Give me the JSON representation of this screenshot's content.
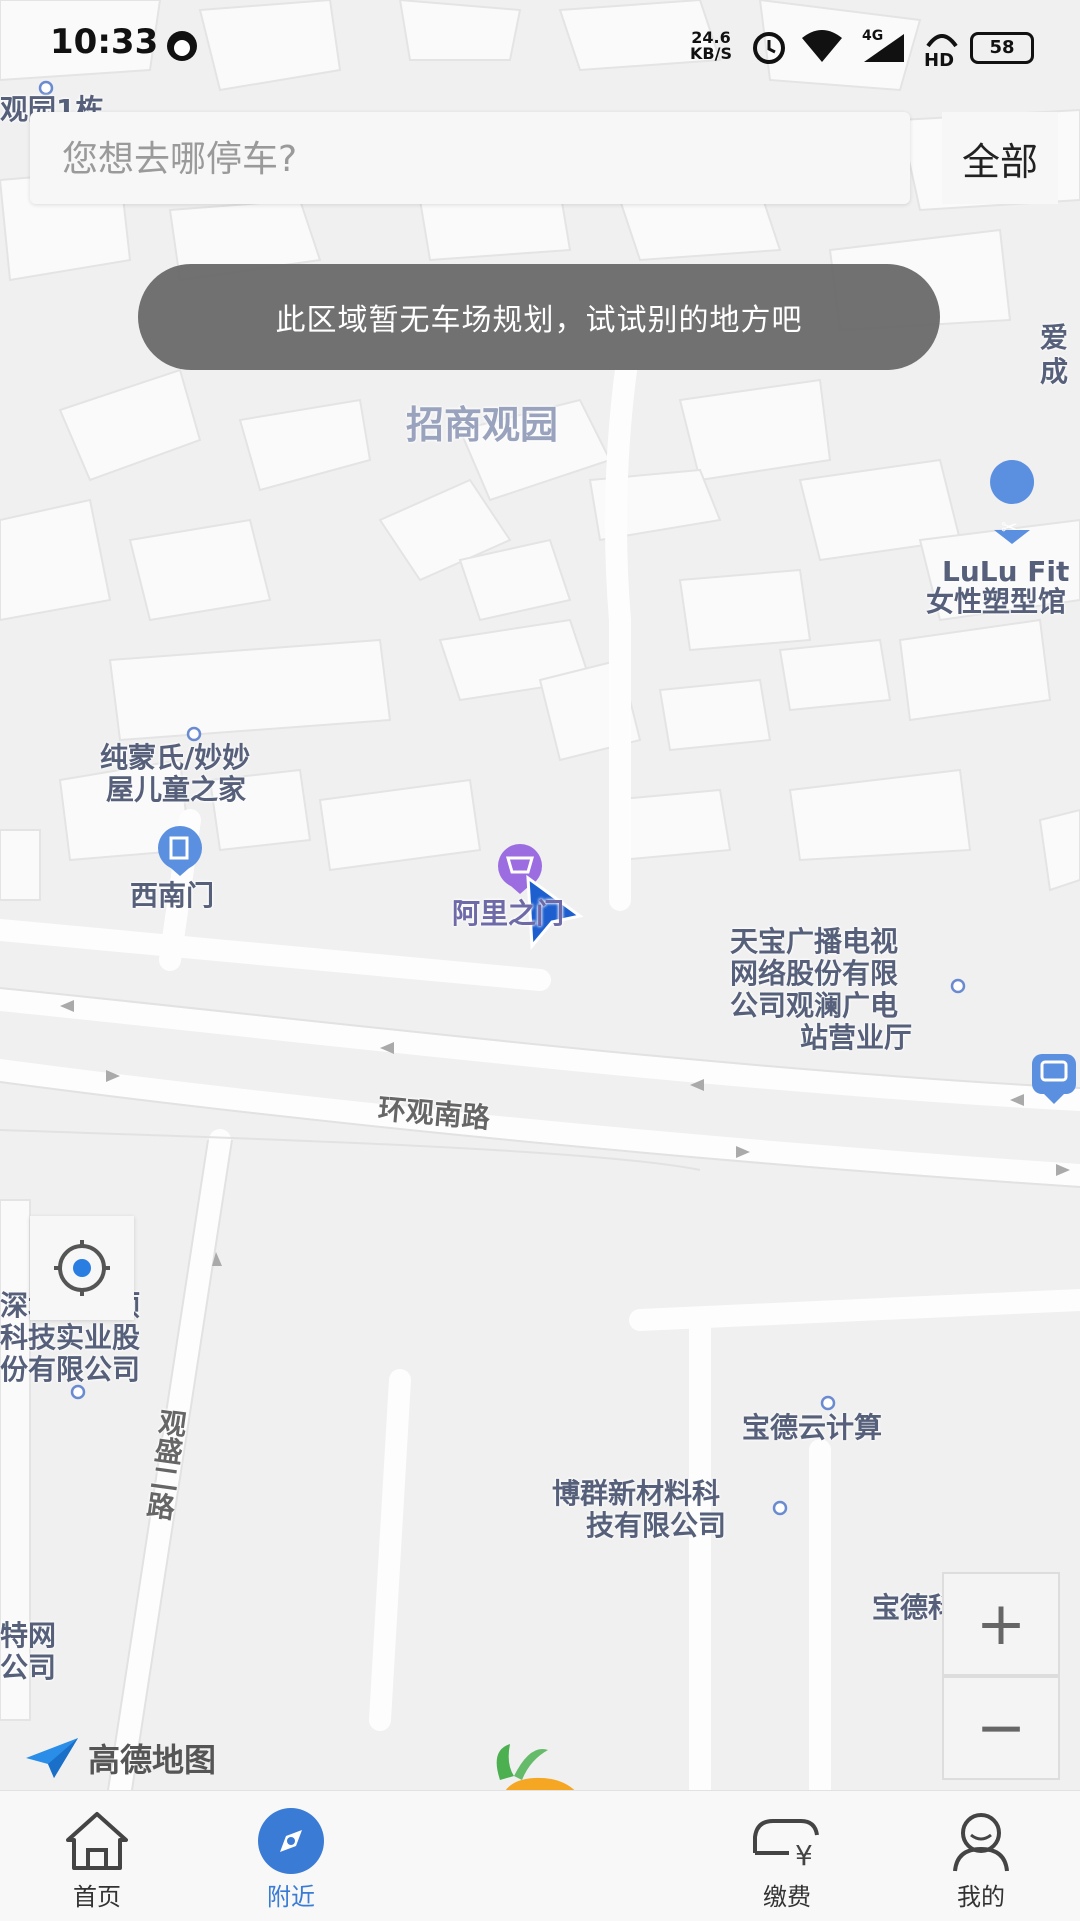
{
  "status_bar": {
    "time": "10:33",
    "speed_value": "24.6",
    "speed_unit": "KB/S",
    "network": "4G",
    "hd": "HD",
    "battery": "58"
  },
  "search": {
    "placeholder": "您想去哪停车?",
    "filter_label": "全部"
  },
  "toast": "此区域暂无车场规划，试试别的地方吧",
  "map": {
    "labels": {
      "area_top_left": "观园1栋",
      "area_main": "招商观园",
      "poi_top_right": "爱",
      "poi_top_right2": "成",
      "lulu1": "LuLu Fit",
      "lulu2": "女性塑型馆",
      "kids1": "纯蒙氏/妙妙",
      "kids2": "屋儿童之家",
      "southwest_gate": "西南门",
      "ali_gate": "阿里之门",
      "tianbao1": "天宝广播电视",
      "tianbao2": "网络股份有限",
      "tianbao3": "公司观澜广电",
      "tianbao4": "站营业厅",
      "road_main": "环观南路",
      "left_co1": "深圳市捷顺",
      "left_co2": "科技实业股",
      "left_co3": "份有限公司",
      "road_vertical": "观盛二路",
      "baode_cloud": "宝德云计算",
      "boqun1": "博群新材料科",
      "boqun2": "技有限公司",
      "baode_tech": "宝德科技集团",
      "bottom_left1": "特网",
      "bottom_left2": "公司"
    },
    "attribution": "高德地图"
  },
  "controls": {
    "zoom_in": "+",
    "zoom_out": "−"
  },
  "nav": {
    "items": [
      {
        "label": "首页",
        "icon": "home-icon"
      },
      {
        "label": "附近",
        "icon": "compass-icon",
        "active": true
      },
      {
        "label": "缴费",
        "icon": "payment-car-icon"
      },
      {
        "label": "我的",
        "icon": "user-icon"
      }
    ]
  },
  "colors": {
    "accent": "#3a7bd5",
    "toast_bg": "#696969",
    "poi_purple": "#9b6de0",
    "poi_blue": "#5b8fe0"
  }
}
